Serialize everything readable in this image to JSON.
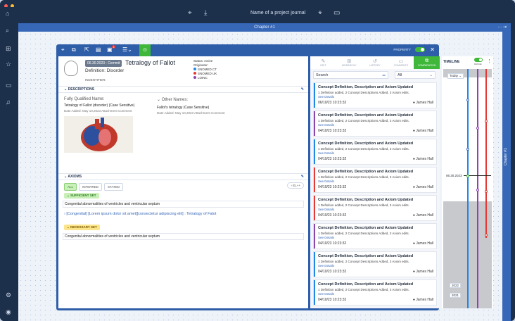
{
  "app": {
    "journal_name": "Name of a project journal",
    "chapter": "Chapter #1",
    "side_tab": "Chapter #1"
  },
  "toolbar": {
    "notification_count": "4"
  },
  "property": {
    "label": "PROPERTY",
    "enabled": true
  },
  "concept": {
    "date_chip": "06.30.2023 : Commit",
    "title": "Tetralogy of Fallot",
    "definition": "Definition: Disorder",
    "identifier_label": "INDENTIFIER:",
    "status": "Status: Active",
    "originator_label": "Originator:",
    "originators": [
      {
        "name": "SNOMED CT",
        "color": "#1e88e5"
      },
      {
        "name": "SNOMED UK",
        "color": "#e53935"
      },
      {
        "name": "LOINC",
        "color": "#8e44ad"
      }
    ]
  },
  "descriptions": {
    "header": "DESCRIPTIONS",
    "fqn_label": "Fully Qualified Name:",
    "fqn_value": "Tetralogy of Fallot (disorder) (Case Sensitive)",
    "fqn_meta": "Date Added: May 10,2023   Attachment  Comment",
    "other_label": "Other Names:",
    "other_value": "Fallot's tetralogy (Case Sensitive)",
    "other_meta": "Date Added: May 10,2023   Attachment  Comment"
  },
  "axioms": {
    "header": "AXIOMS",
    "pills": [
      "ALL",
      "INFERRED",
      "STATED"
    ],
    "el_button": "EL++",
    "sufficient_label": "SUFFICIENT SET",
    "sufficient_row": "Congenital abnormalities of ventricles and ventricular septum",
    "axiom_line": "[Congenital] [Lorem ipsum dolor sit amet][consectetur adipiscing elit] : Tetralogy of Falot",
    "necessary_label": "NECESSARY SET",
    "necessary_row": "Congenital abnormalities of ventricles and ventricular septum"
  },
  "mid_tabs": [
    "EDIT",
    "HIERARCHY",
    "HISTORY",
    "COMMENTS",
    "COMPARATION"
  ],
  "search": {
    "placeholder": "Search",
    "filter_value": "All"
  },
  "cards": [
    {
      "title": "Concept Definition, Description and Axiom Updated",
      "desc": "1 Definition added, 2 Concept Descriptions Added, 3 Axiom edits.",
      "link": "See Details",
      "date": "06/10/23 10:23:32",
      "user": "James Hall",
      "color": "#1e88e5"
    },
    {
      "title": "Concept Definition, Description and Axiom Updated",
      "desc": "1 Definition added, 2 Concept Descriptions Added, 3 Axiom edits.",
      "link": "See Details",
      "date": "04/10/23 10:23:32",
      "user": "James Hall",
      "color": "#8e44ad"
    },
    {
      "title": "Concept Definition, Description and Axiom Updated",
      "desc": "1 Definition added, 2 Concept Descriptions Added, 3 Axiom edits.",
      "link": "See Details",
      "date": "04/10/23 10:23:32",
      "user": "James Hall",
      "color": "#1e88e5"
    },
    {
      "title": "Concept Definition, Description and Axiom Updated",
      "desc": "1 Definition added, 2 Concept Descriptions Added, 3 Axiom edits.",
      "link": "See Details",
      "date": "04/10/23 10:23:32",
      "user": "James Hall",
      "color": "#e53935"
    },
    {
      "title": "Concept Definition, Description and Axiom Updated",
      "desc": "1 Definition added, 2 Concept Descriptions Added, 3 Axiom edits.",
      "link": "See Details",
      "date": "04/10/23 10:23:32",
      "user": "James Hall",
      "color": "#e53935"
    },
    {
      "title": "Concept Definition, Description and Axiom Updated",
      "desc": "1 Definition added, 2 Concept Descriptions Added, 3 Axiom edits.",
      "link": "See Details",
      "date": "04/10/23 10:23:32",
      "user": "James Hall",
      "color": "#8e44ad"
    },
    {
      "title": "Concept Definition, Description and Axiom Updated",
      "desc": "1 Definition added, 2 Concept Descriptions Added, 3 Axiom edits.",
      "link": "See Details",
      "date": "04/10/23 10:23:32",
      "user": "James Hall",
      "color": "#1e88e5"
    },
    {
      "title": "Concept Definition, Description and Axiom Updated",
      "desc": "1 Definition added, 2 Concept Descriptions Added, 3 Axiom edits.",
      "link": "See Details",
      "date": "04/10/23 10:23:32",
      "user": "James Hall",
      "color": "#1e88e5"
    }
  ],
  "timeline": {
    "label": "TIMELINE",
    "toggle_label": "RANGE",
    "today": "Today",
    "selected_date": "06.30.2023",
    "years": [
      "2022",
      "2021"
    ]
  }
}
